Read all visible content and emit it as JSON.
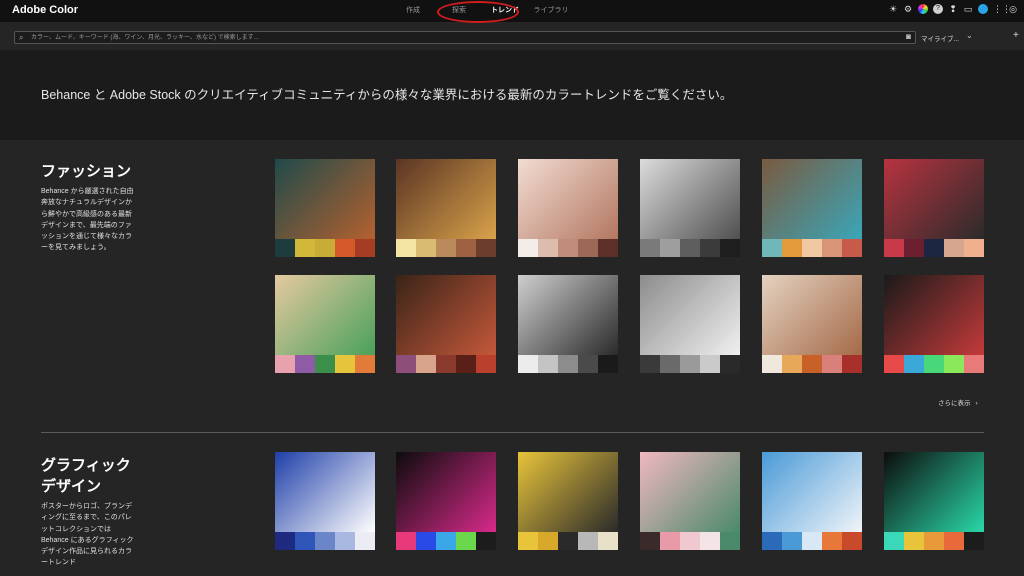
{
  "app": {
    "title": "Adobe Color",
    "tabs": [
      {
        "label": "作成"
      },
      {
        "label": "探索"
      },
      {
        "label": "トレンド"
      },
      {
        "label": "ライブラリ"
      }
    ],
    "top_icons": [
      "sun-icon",
      "settings-icon",
      "color-wheel-icon",
      "help-icon",
      "feedback-icon",
      "chat-icon",
      "user-avatar-icon",
      "apps-grid-icon",
      "creative-cloud-icon"
    ]
  },
  "search": {
    "placeholder": "カラー、ムード、キーワード (海、ワイン、月光、ラッキー、水など) で検索します...",
    "library_label": "マイライブ...",
    "plus": "+"
  },
  "hero": {
    "text": "Behance と Adobe Stock のクリエイティブコミュニティからの様々な業界における最新のカラートレンドをご覧ください。"
  },
  "sections": [
    {
      "title": "ファッション",
      "description": "Behance から厳選された自由奔放なナチュラルデザインから鮮やかで高級感のある最新デザインまで、最先端のファッションを通じて様々なカラーを見てみましょう。",
      "more": "さらに表示",
      "cards": [
        {
          "photo": [
            "#1f4a4a",
            "#b4612f"
          ],
          "swatches": [
            "#1c3c3d",
            "#d2b838",
            "#c9ac36",
            "#d4582a",
            "#a53c24"
          ]
        },
        {
          "photo": [
            "#5a3524",
            "#d9a24a"
          ],
          "swatches": [
            "#f4e4a4",
            "#d9bb72",
            "#bb8a5c",
            "#9e6243",
            "#6c3c2c"
          ]
        },
        {
          "photo": [
            "#f2dcd2",
            "#b37761"
          ],
          "swatches": [
            "#f2ede9",
            "#dcbcac",
            "#c08c7c",
            "#9c6858",
            "#5c3028"
          ]
        },
        {
          "photo": [
            "#dcdcdc",
            "#505050"
          ],
          "swatches": [
            "#7a7a7a",
            "#9e9e9e",
            "#5e5e5e",
            "#3b3b3b",
            "#1e1e1e"
          ]
        },
        {
          "photo": [
            "#7a5a40",
            "#3aa6b8"
          ],
          "swatches": [
            "#6fb7b8",
            "#e39a3b",
            "#f0c9a4",
            "#d99478",
            "#c85a49"
          ]
        },
        {
          "photo": [
            "#b8333f",
            "#2b2b2b"
          ],
          "swatches": [
            "#c83a49",
            "#6b1e2e",
            "#1c2640",
            "#d7a68f",
            "#f0b08e"
          ]
        },
        {
          "photo": [
            "#e5c9a0",
            "#4aa05a"
          ],
          "swatches": [
            "#e8a2ad",
            "#8e5ca6",
            "#3c8f4a",
            "#e5c53b",
            "#e27a3a"
          ]
        },
        {
          "photo": [
            "#3a2418",
            "#c4583a"
          ],
          "swatches": [
            "#8d4f7a",
            "#d9a48c",
            "#8a3a2c",
            "#5a2018",
            "#b8402c"
          ]
        },
        {
          "photo": [
            "#cfcfcf",
            "#2a2a2a"
          ],
          "swatches": [
            "#ececec",
            "#c4c4c4",
            "#8c8c8c",
            "#4a4a4a",
            "#1a1a1a"
          ]
        },
        {
          "photo": [
            "#8c8c8c",
            "#f0f0f0"
          ],
          "swatches": [
            "#3a3a3a",
            "#6a6a6a",
            "#9a9a9a",
            "#cacaca",
            "#2a2a2a"
          ]
        },
        {
          "photo": [
            "#e4d2c0",
            "#a56a48"
          ],
          "swatches": [
            "#f0e8dc",
            "#e8a85a",
            "#c8602a",
            "#d9807a",
            "#a8302a"
          ]
        },
        {
          "photo": [
            "#1a1a1a",
            "#c43a3a"
          ],
          "swatches": [
            "#e84a4a",
            "#3aa8d8",
            "#48d87a",
            "#8ae85a",
            "#e87a7a"
          ]
        }
      ]
    },
    {
      "title": "グラフィックデザイン",
      "description": "ポスターからロゴ、ブランディングに至るまで、このパレットコレクションでは Behance にあるグラフィックデザイン作品に見られるカラートレンド",
      "cards": [
        {
          "photo": [
            "#1f3fa8",
            "#ffffff"
          ],
          "swatches": [
            "#1e2a80",
            "#2f55b8",
            "#6a86c9",
            "#a9b8e0",
            "#ececf4"
          ]
        },
        {
          "photo": [
            "#0c0c0c",
            "#d82a8a"
          ],
          "swatches": [
            "#e83a7a",
            "#2a4ae8",
            "#3aa8e8",
            "#6ad84a",
            "#1c1c1c"
          ]
        },
        {
          "photo": [
            "#e8c43a",
            "#2a2a2a"
          ],
          "swatches": [
            "#e8c43a",
            "#d8a82a",
            "#2a2a2a",
            "#b8b8b8",
            "#e8e0c8"
          ]
        },
        {
          "photo": [
            "#f0b8c0",
            "#4a8a6a"
          ],
          "swatches": [
            "#3a2a2a",
            "#e89aa8",
            "#f0c8d0",
            "#f4e4e8",
            "#4a8a6a"
          ]
        },
        {
          "photo": [
            "#4a9ad8",
            "#f0f4f8"
          ],
          "swatches": [
            "#2a6ab8",
            "#4a9ad8",
            "#d8e8f4",
            "#e8783a",
            "#c84a2a"
          ]
        },
        {
          "photo": [
            "#0c0c0c",
            "#2ad8a8"
          ],
          "swatches": [
            "#3ad8b8",
            "#e8c43a",
            "#e89a3a",
            "#e86a3a",
            "#1c1c1c"
          ]
        }
      ]
    }
  ]
}
